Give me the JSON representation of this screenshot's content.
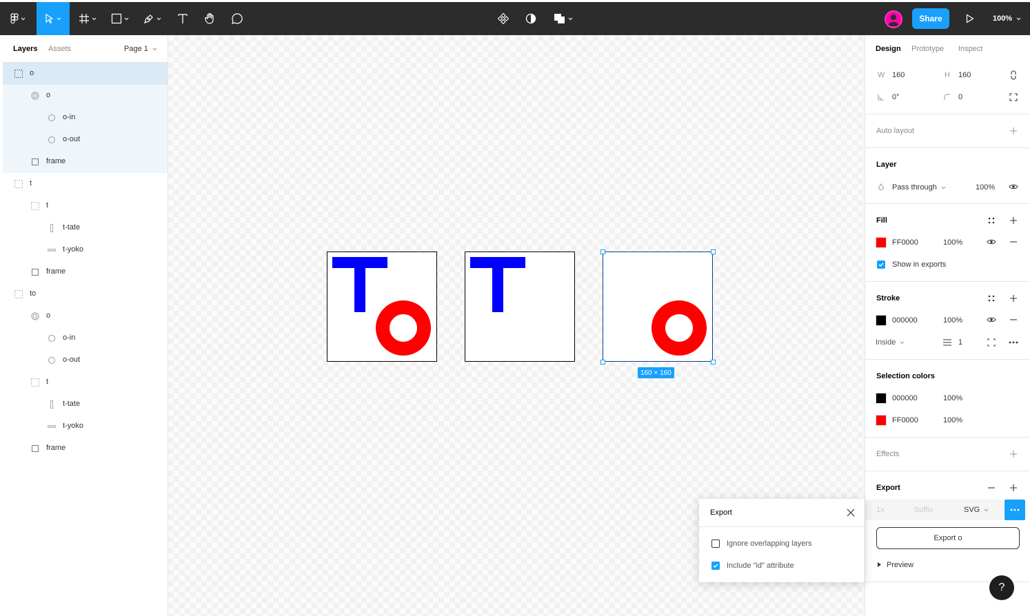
{
  "toolbar": {
    "share_label": "Share",
    "zoom_label": "100%"
  },
  "layers_panel": {
    "tabs": [
      "Layers",
      "Assets"
    ],
    "page_label": "Page 1",
    "layers": [
      {
        "label": "o",
        "icon": "frame-icon"
      },
      {
        "label": "o",
        "icon": "boolean-group-icon"
      },
      {
        "label": "o-in",
        "icon": "ellipse-icon"
      },
      {
        "label": "o-out",
        "icon": "ellipse-icon"
      },
      {
        "label": "frame",
        "icon": "rectangle-icon"
      },
      {
        "label": "t",
        "icon": "frame-icon"
      },
      {
        "label": "t",
        "icon": "frame-icon"
      },
      {
        "label": "t-tate",
        "icon": "vertical-rect-icon"
      },
      {
        "label": "t-yoko",
        "icon": "horizontal-rect-icon"
      },
      {
        "label": "frame",
        "icon": "rectangle-icon"
      },
      {
        "label": "to",
        "icon": "frame-icon"
      },
      {
        "label": "o",
        "icon": "boolean-group-icon"
      },
      {
        "label": "o-in",
        "icon": "ellipse-icon"
      },
      {
        "label": "o-out",
        "icon": "ellipse-icon"
      },
      {
        "label": "t",
        "icon": "frame-icon"
      },
      {
        "label": "t-tate",
        "icon": "vertical-rect-icon"
      },
      {
        "label": "t-yoko",
        "icon": "horizontal-rect-icon"
      },
      {
        "label": "frame",
        "icon": "rectangle-icon"
      }
    ]
  },
  "canvas": {
    "selection_size": "160 × 160",
    "colors": {
      "blue": "#0000ff",
      "red": "#ff0000"
    }
  },
  "design_panel": {
    "tabs": [
      "Design",
      "Prototype",
      "Inspect"
    ],
    "w_label": "W",
    "w_value": "160",
    "h_label": "H",
    "h_value": "160",
    "rotation": "0°",
    "radius": "0",
    "auto_layout": "Auto layout",
    "layer": {
      "title": "Layer",
      "blend": "Pass through",
      "opacity": "100%"
    },
    "fill": {
      "title": "Fill",
      "hex": "FF0000",
      "opacity": "100%",
      "swatch": "#ff0000",
      "show_in_exports": "Show in exports"
    },
    "stroke": {
      "title": "Stroke",
      "hex": "000000",
      "opacity": "100%",
      "swatch": "#000000",
      "position": "Inside",
      "weight": "1"
    },
    "selection_colors": {
      "title": "Selection colors",
      "items": [
        {
          "hex": "000000",
          "opacity": "100%",
          "swatch": "#000000"
        },
        {
          "hex": "FF0000",
          "opacity": "100%",
          "swatch": "#ff0000"
        }
      ]
    },
    "effects": "Effects",
    "export": {
      "title": "Export",
      "scale_placeholder": "1x",
      "suffix_placeholder": "Suffix",
      "format": "SVG",
      "button_label": "Export o",
      "preview_label": "Preview"
    },
    "help_label": "?"
  },
  "export_popup": {
    "title": "Export",
    "options": [
      {
        "label": "Ignore overlapping layers",
        "checked": false
      },
      {
        "label": "Include \"id\" attribute",
        "checked": true
      }
    ]
  }
}
